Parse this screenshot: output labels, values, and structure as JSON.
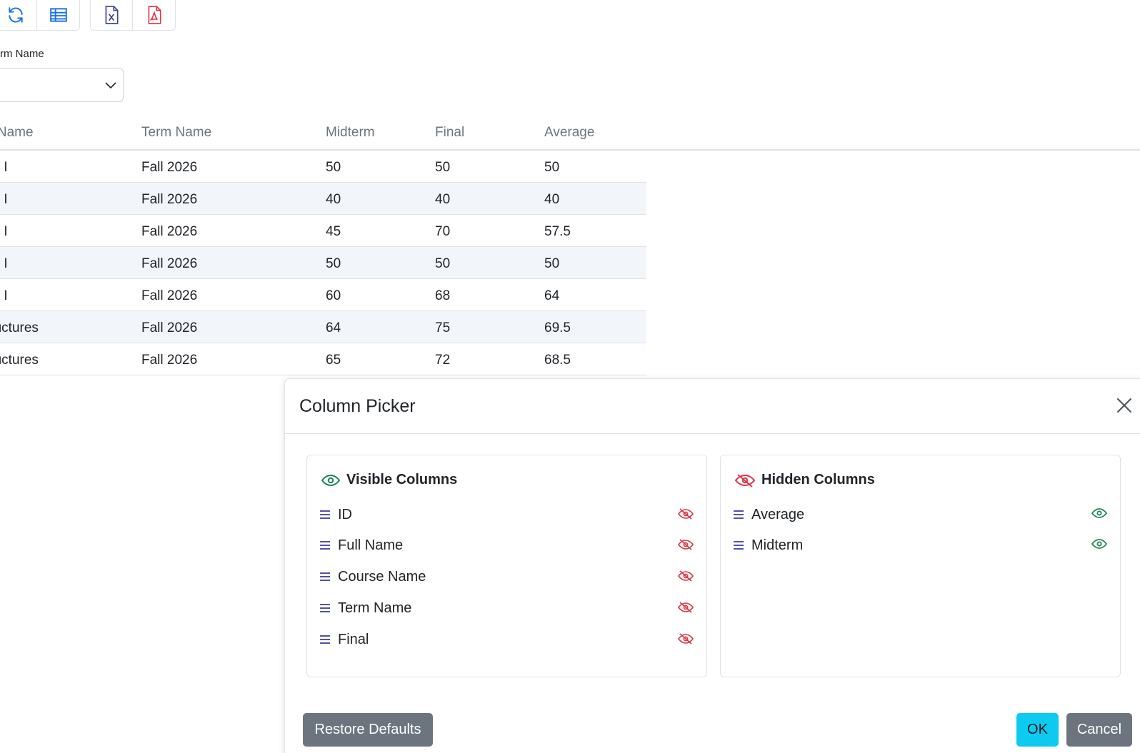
{
  "toolbar": {
    "buttons": [
      {
        "name": "refresh",
        "icon": "refresh-icon",
        "color": "#1a73e8"
      },
      {
        "name": "table-view",
        "icon": "table-icon",
        "color": "#1a73e8"
      },
      {
        "name": "export-excel",
        "icon": "excel-file-icon",
        "color": "#3b3b98"
      },
      {
        "name": "export-pdf",
        "icon": "pdf-file-icon",
        "color": "#dc3545"
      }
    ]
  },
  "filter": {
    "label": "rm Name",
    "value": ""
  },
  "grid": {
    "columns": [
      "e Name",
      "Term Name",
      "Midterm",
      "Final",
      "Average"
    ],
    "rows": [
      {
        "course": "us I",
        "term": "Fall 2026",
        "midterm": "50",
        "final": "50",
        "average": "50"
      },
      {
        "course": "us I",
        "term": "Fall 2026",
        "midterm": "40",
        "final": "40",
        "average": "40"
      },
      {
        "course": "us I",
        "term": "Fall 2026",
        "midterm": "45",
        "final": "70",
        "average": "57.5"
      },
      {
        "course": "us I",
        "term": "Fall 2026",
        "midterm": "50",
        "final": "50",
        "average": "50"
      },
      {
        "course": "us I",
        "term": "Fall 2026",
        "midterm": "60",
        "final": "68",
        "average": "64"
      },
      {
        "course": "tructures",
        "term": "Fall 2026",
        "midterm": "64",
        "final": "75",
        "average": "69.5"
      },
      {
        "course": "tructures",
        "term": "Fall 2026",
        "midterm": "65",
        "final": "72",
        "average": "68.5"
      }
    ]
  },
  "dialog": {
    "title": "Column Picker",
    "visible_title": "Visible Columns",
    "hidden_title": "Hidden Columns",
    "visible_columns": [
      "ID",
      "Full Name",
      "Course Name",
      "Term Name",
      "Final"
    ],
    "hidden_columns": [
      "Average",
      "Midterm"
    ],
    "restore_label": "Restore Defaults",
    "ok_label": "OK",
    "cancel_label": "Cancel"
  },
  "colors": {
    "visible_icon": "#198754",
    "hidden_icon": "#dc3545",
    "drag_handle": "#3b3b98",
    "ok_button": "#0dcaf0",
    "secondary_button": "#6c757d",
    "alt_row": "#f2f5f9"
  }
}
